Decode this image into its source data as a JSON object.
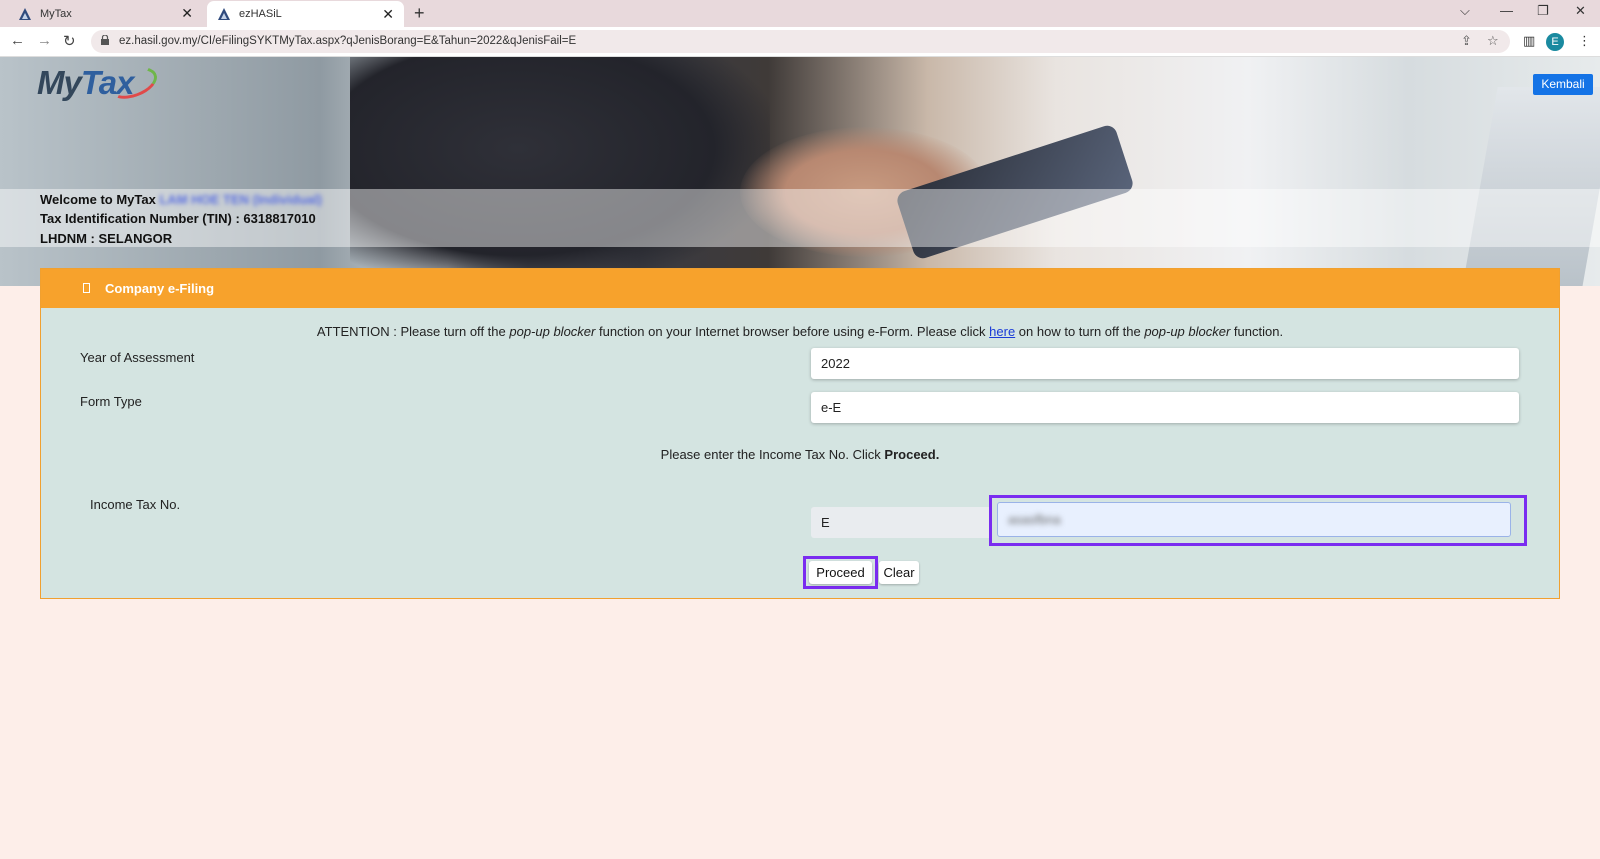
{
  "browser": {
    "tabs": [
      {
        "title": "MyTax",
        "active": false
      },
      {
        "title": "ezHASiL",
        "active": true
      }
    ],
    "url": "ez.hasil.gov.my/CI/eFilingSYKTMyTax.aspx?qJenisBorang=E&Tahun=2022&qJenisFail=E",
    "profile_initial": "E",
    "icons": {
      "back": "back-arrow-icon",
      "forward": "forward-arrow-icon",
      "reload": "reload-icon",
      "lock": "lock-icon",
      "share": "share-icon",
      "bookmark": "star-icon",
      "sidepanel": "side-panel-icon",
      "menu": "kebab-menu-icon"
    }
  },
  "header": {
    "logo_text_1": "My",
    "logo_text_2": "Tax",
    "back_button": "Kembali",
    "welcome_prefix": "Welcome to MyTax",
    "welcome_name": "LAM HOE TEN (Individual)",
    "tin_line": "Tax Identification Number (TIN) : 6318817010",
    "lhdnm_line": "LHDNM : SELANGOR"
  },
  "panel": {
    "title": "Company e-Filing",
    "attention_1": "ATTENTION : Please turn off the ",
    "attention_popup_1": "pop-up blocker",
    "attention_2": " function on your Internet browser before using e-Form. Please click ",
    "attention_link": "here",
    "attention_3": " on how to turn off the ",
    "attention_popup_2": "pop-up blocker",
    "attention_4": " function.",
    "year_label": "Year of Assessment",
    "year_value": "2022",
    "form_type_label": "Form Type",
    "form_type_value": "e-E",
    "prompt_text": "Please enter the Income Tax No. Click ",
    "prompt_bold": "Proceed.",
    "tax_no_label": "Income Tax No.",
    "tax_no_prefix": "E",
    "tax_no_value": "asasfbna",
    "proceed_button": "Proceed",
    "clear_button": "Clear"
  },
  "colors": {
    "panel_header": "#f7a22c",
    "panel_body": "#d4e4e1",
    "highlight": "#7a2cf0",
    "kembali": "#1473e6",
    "page_bg": "#fdeee9"
  }
}
